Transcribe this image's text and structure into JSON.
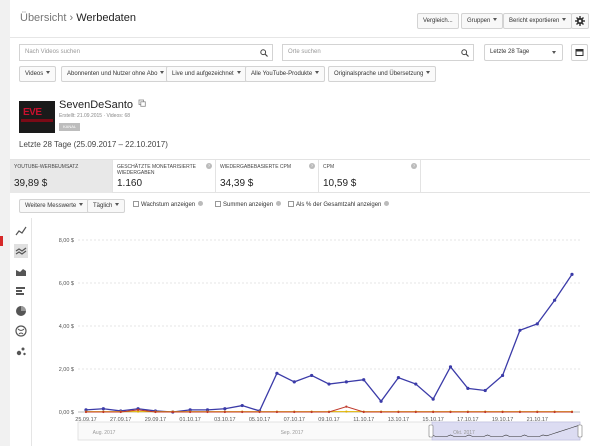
{
  "header": {
    "crumb_parent": "Übersicht",
    "crumb_sep": " › ",
    "crumb_current": "Werbedaten",
    "compare_label": "Vergleich...",
    "groups_label": "Gruppen",
    "export_label": "Bericht exportieren"
  },
  "search": {
    "videos_placeholder": "Nach Videos suchen",
    "places_placeholder": "Orte suchen",
    "period_label": "Letzte 28 Tage"
  },
  "filters": [
    "Videos",
    "Abonnenten und Nutzer ohne Abo",
    "Live und aufgezeichnet",
    "Alle YouTube-Produkte",
    "Originalsprache und Übersetzung"
  ],
  "channel": {
    "thumb_text": "EVE",
    "name": "SevenDeSanto",
    "meta": "Erstellt: 21.09.2015 · Videos: 68",
    "badge": "KANAL"
  },
  "date_range": "Letzte 28 Tage (25.09.2017 – 22.10.2017)",
  "metrics": [
    {
      "label": "YOUTUBE-WERBEUMSATZ",
      "value": "39,89 $"
    },
    {
      "label": "GESCHÄTZTE MONETARISIERTE WIEDERGABEN",
      "value": "1.160"
    },
    {
      "label": "WIEDERGABEBASIERTE CPM",
      "value": "34,39 $"
    },
    {
      "label": "CPM",
      "value": "10,59 $"
    }
  ],
  "options": {
    "more_metrics": "Weitere Messwerte",
    "daily": "Täglich",
    "sum_label": "Wachstum anzeigen",
    "totals_label": "Summen anzeigen",
    "percent_label": "Als % der Gesamtzahl anzeigen"
  },
  "colors": {
    "primary_line": "#3b3ba8",
    "secondary_line": "#e0b400",
    "tertiary_line": "#c0392b",
    "quaternary_line": "#2e8b57",
    "selected_tab": "#e8e8e8",
    "accent_red": "#d62828"
  },
  "side_icons": [
    "line-chart-icon",
    "multi-line-chart-icon",
    "stacked-area-icon",
    "bar-list-icon",
    "pie-chart-icon",
    "globe-icon",
    "bubble-chart-icon"
  ],
  "chart_data": {
    "type": "line",
    "x": [
      "25.09.17",
      "26.09.17",
      "27.09.17",
      "28.09.17",
      "29.09.17",
      "30.09.17",
      "01.10.17",
      "02.10.17",
      "03.10.17",
      "04.10.17",
      "05.10.17",
      "06.10.17",
      "07.10.17",
      "08.10.17",
      "09.10.17",
      "10.10.17",
      "11.10.17",
      "12.10.17",
      "13.10.17",
      "14.10.17",
      "15.10.17",
      "16.10.17",
      "17.10.17",
      "18.10.17",
      "19.10.17",
      "20.10.17",
      "21.10.17",
      "22.10.17"
    ],
    "x_tick_labels": [
      "25.09.17",
      "27.09.17",
      "29.09.17",
      "01.10.17",
      "03.10.17",
      "05.10.17",
      "07.10.17",
      "09.10.17",
      "11.10.17",
      "13.10.17",
      "15.10.17",
      "17.10.17",
      "19.10.17",
      "21.10.17"
    ],
    "series": [
      {
        "values": [
          0.1,
          0.15,
          0.05,
          0.15,
          0.05,
          0.0,
          0.1,
          0.1,
          0.15,
          0.3,
          0.05,
          1.8,
          1.4,
          1.7,
          1.3,
          1.4,
          1.5,
          0.5,
          1.6,
          1.3,
          0.6,
          2.1,
          1.1,
          1.0,
          1.7,
          3.8,
          4.1,
          5.2,
          6.4
        ]
      },
      {
        "values": [
          0.02,
          0.02,
          0.02,
          0.02,
          0.02,
          0.02,
          0.02,
          0.02,
          0.02,
          0.02,
          0.02,
          0.02,
          0.02,
          0.02,
          0.02,
          0.02,
          0.02,
          0.02,
          0.02,
          0.02,
          0.02,
          0.02,
          0.02,
          0.02,
          0.02,
          0.02,
          0.02,
          0.02,
          0.02
        ]
      },
      {
        "values": [
          0.0,
          0.0,
          0.0,
          0.1,
          0.0,
          0.0,
          0.0,
          0.0,
          0.0,
          0.0,
          0.0,
          0.0,
          0.0,
          0.0,
          0.0,
          0.25,
          0.0,
          0.0,
          0.0,
          0.0,
          0.0,
          0.0,
          0.0,
          0.0,
          0.0,
          0.0,
          0.0,
          0.0,
          0.0
        ]
      }
    ],
    "ylim": [
      0,
      8
    ],
    "y_ticks": [
      "0,00 $",
      "2,00 $",
      "4,00 $",
      "6,00 $",
      "8,00 $"
    ],
    "y_tick_values": [
      0,
      2,
      4,
      6,
      8
    ],
    "grid": true,
    "overview": {
      "labels": [
        "Aug. 2017",
        "Sep. 2017",
        "Okt. 2017"
      ]
    }
  }
}
